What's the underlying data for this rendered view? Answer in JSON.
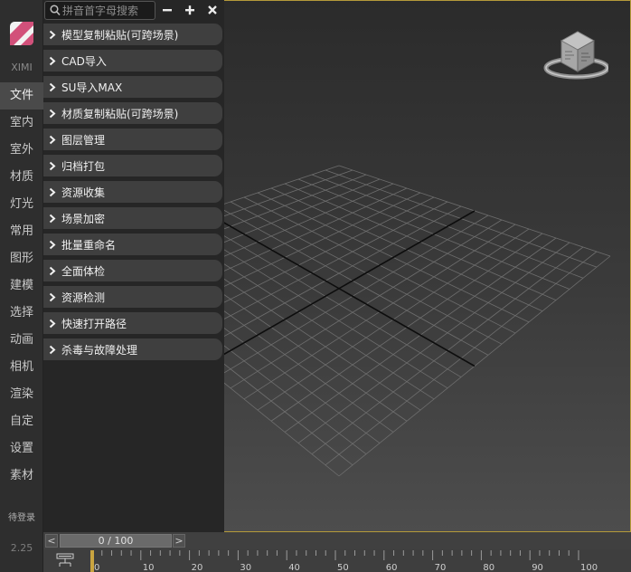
{
  "app": {
    "brand": "XIMI",
    "login_status": "待登录",
    "version": "2.25",
    "colors": {
      "accent": "#d2507a",
      "viewport_border": "#b59a3a",
      "time_marker": "#c9a440"
    }
  },
  "sidebar": {
    "categories": [
      {
        "label": "文件",
        "active": true
      },
      {
        "label": "室内"
      },
      {
        "label": "室外"
      },
      {
        "label": "材质"
      },
      {
        "label": "灯光"
      },
      {
        "label": "常用"
      },
      {
        "label": "图形"
      },
      {
        "label": "建模"
      },
      {
        "label": "选择"
      },
      {
        "label": "动画"
      },
      {
        "label": "相机"
      },
      {
        "label": "渲染"
      },
      {
        "label": "自定"
      },
      {
        "label": "设置"
      },
      {
        "label": "素材"
      }
    ]
  },
  "panel": {
    "search_placeholder": "拼音首字母搜索",
    "toolbar_icons": [
      "minus-icon",
      "plus-icon",
      "close-icon"
    ],
    "menu_items": [
      {
        "label": "模型复制粘贴(可跨场景)"
      },
      {
        "label": "CAD导入"
      },
      {
        "label": "SU导入MAX"
      },
      {
        "label": "材质复制粘贴(可跨场景)"
      },
      {
        "label": "图层管理"
      },
      {
        "label": "归档打包"
      },
      {
        "label": "资源收集"
      },
      {
        "label": "场景加密"
      },
      {
        "label": "批量重命名"
      },
      {
        "label": "全面体检"
      },
      {
        "label": "资源检测"
      },
      {
        "label": "快速打开路径"
      },
      {
        "label": "杀毒与故障处理"
      }
    ]
  },
  "viewport": {
    "view_cube_icon": "view-cube-icon",
    "grid": true
  },
  "timeslider": {
    "frame_label": "0 / 100",
    "prev_label": "<",
    "next_label": ">",
    "current_frame": 0,
    "total_frames": 100
  },
  "timeline": {
    "ticks": [
      "0",
      "10",
      "20",
      "30",
      "40",
      "50",
      "60",
      "70",
      "80",
      "90",
      "100"
    ]
  }
}
